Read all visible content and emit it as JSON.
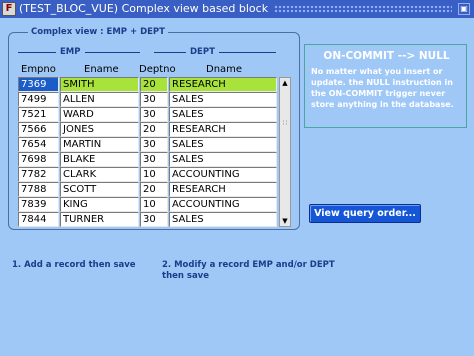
{
  "window": {
    "icon_glyph": "F",
    "title": "(TEST_BLOC_VUE)  Complex view based block",
    "btn_glyph": "▣"
  },
  "frame": {
    "title": "Complex view : EMP + DEPT",
    "group_emp": "EMP",
    "group_dept": "DEPT",
    "columns": [
      "Empno",
      "Ename",
      "Deptno",
      "Dname"
    ]
  },
  "rows": [
    {
      "empno": "7369",
      "ename": "SMITH",
      "deptno": "20",
      "dname": "RESEARCH",
      "current": true
    },
    {
      "empno": "7499",
      "ename": "ALLEN",
      "deptno": "30",
      "dname": "SALES"
    },
    {
      "empno": "7521",
      "ename": "WARD",
      "deptno": "30",
      "dname": "SALES"
    },
    {
      "empno": "7566",
      "ename": "JONES",
      "deptno": "20",
      "dname": "RESEARCH"
    },
    {
      "empno": "7654",
      "ename": "MARTIN",
      "deptno": "30",
      "dname": "SALES"
    },
    {
      "empno": "7698",
      "ename": "BLAKE",
      "deptno": "30",
      "dname": "SALES"
    },
    {
      "empno": "7782",
      "ename": "CLARK",
      "deptno": "10",
      "dname": "ACCOUNTING"
    },
    {
      "empno": "7788",
      "ename": "SCOTT",
      "deptno": "20",
      "dname": "RESEARCH"
    },
    {
      "empno": "7839",
      "ename": "KING",
      "deptno": "10",
      "dname": "ACCOUNTING"
    },
    {
      "empno": "7844",
      "ename": "TURNER",
      "deptno": "30",
      "dname": "SALES"
    }
  ],
  "scrollbar": {
    "up_glyph": "▲",
    "down_glyph": "▼",
    "thumb_glyph": "∷"
  },
  "info": {
    "title": "ON-COMMIT --> NULL",
    "body": "No matter what you insert or update. the NULL instruction in the ON-COMMIT trigger never store anything in the database."
  },
  "buttons": {
    "view_query": "View query order..."
  },
  "instructions": {
    "step1": "1. Add a record then save",
    "step2_line1": "2. Modify a record EMP and/or DEPT",
    "step2_line2": "then save"
  },
  "colors": {
    "background": "#9fc8f7",
    "titlebar": "#3a5fc4",
    "current_row": "#a8e33b",
    "button": "#1456d6"
  }
}
